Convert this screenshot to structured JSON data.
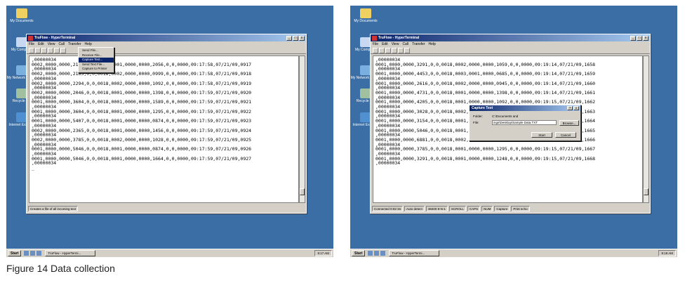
{
  "caption": "Figure 14    Data collection",
  "desktop_icons": [
    {
      "label": "My Documents",
      "icon": "folder-icon"
    },
    {
      "label": "My Computer",
      "icon": "computer-icon"
    },
    {
      "label": "My Network Places",
      "icon": "network-icon"
    },
    {
      "label": "Recycle Bin",
      "icon": "recycle-bin-icon"
    },
    {
      "label": "Internet Explorer",
      "icon": "internet-explorer-icon"
    }
  ],
  "window": {
    "title": "TruFlow - HyperTerminal",
    "menus": [
      "File",
      "Edit",
      "View",
      "Call",
      "Transfer",
      "Help"
    ],
    "controls": [
      "_",
      "□",
      "x"
    ]
  },
  "left": {
    "terminal_lines": [
      ",00000034",
      "0002,0000,0000,2105,0,0,0018,0001,0000,0000,2056,0,0,0000,09:17:58,07/21/09,0917",
      ",00000034",
      "0002,0000,0000,2163,0,0,0018,0002,0000,0000,0999,0,0,0000,09:17:58,07/21/09,0918",
      ",00000034",
      "0002,0000,0000,2294,0,0,0018,0002,0000,0000,1092,0,0,0000,09:17:58,07/21/09,0919",
      ",00000034",
      "0002,0000,0000,2046,0,0,0018,0001,0000,0000,1398,0,0,0000,09:17:59,07/21/09,0920",
      ",00000034",
      "0001,0000,0000,3604,0,0,0018,0001,0000,0000,1589,0,0,0000,09:17:59,07/21/09,0921",
      ",00000034",
      "0001,0000,0000,3604,0,0,0018,0001,0000,0000,1295,0,0,0000,09:17:59,07/21/09,0922",
      ",00000034",
      "0001,0000,0000,5407,0,0,0018,0001,0000,0000,0874,0,0,0000,09:17:59,07/21/09,0923",
      ",00000034",
      "0002,0000,0000,2365,0,0,0018,0001,0000,0000,1456,0,0,0000,09:17:59,07/21/09,0924",
      ",00000034",
      "0002,0000,0000,3785,0,0,0018,0002,0000,0000,1028,0,0,0000,09:17:59,07/21/09,0925",
      ",00000034",
      "0001,0000,0000,5046,0,0,0018,0001,0000,0000,0874,0,0,0000,09:17:59,07/21/09,0926",
      ",00000034",
      "0001,0000,0000,5046,0,0,0018,0001,0000,0000,1664,0,0,0000,09:17:59,07/21/09,0927",
      ",00000034",
      "_"
    ],
    "transfer_menu": [
      "Send File...",
      "Receive File...",
      "Capture Text...",
      "Send Text File...",
      "Capture to Printer"
    ],
    "status": "Creates a file of all incoming text",
    "task_label": "TruFlow - HyperTermi...",
    "clock": "9:17 AM"
  },
  "right": {
    "terminal_lines": [
      ",00000034",
      "0001,0000,0000,3291,0,0,0018,0002,0000,0000,1059,0,0,0000,09:19:14,07/21/09,1658",
      ",00000034",
      "0001,0000,0000,4453,0,0,0018,0003,0001,0000,0685,0,0,0000,09:19:14,07/21/09,1659",
      ",00000034",
      "0001,0000,0000,2616,0,0,0018,0002,0000,0000,0945,0,0,0000,09:19:14,07/21/09,1660",
      ",00000034",
      "0001,0000,0000,4731,0,0,0018,0001,0000,0000,1398,0,0,0000,09:19:14,07/21/09,1661",
      ",00000034",
      "0001,0000,0000,4205,0,0,0018,0001,0000,0000,1092,0,0,0000,09:19:15,07/21/09,1662",
      ",00000034",
      "0001,0000,0000,3028,0,0,0018,0002,0000,0000,0874,0,0,0000,09:19:15,07/21/09,1663",
      ",00000034",
      "0001,0000,0000,3154,0,0,0018,0001,0000,0000,1456,0,0,0000,09:19:15,07/21/09,1664",
      ",00000034",
      "0001,0000,0000,5046,0,0,0018,0001,0000,0000,1344,0,0,0000,09:19:15,07/21/09,1665",
      ",00000034",
      "0001,0000,0000,6881,0,0,0018,0002,0000,0000,0853,0,0,0000,09:19:15,07/21/09,1666",
      ",00000034",
      "0001,0000,0000,3785,0,0,0018,0001,0000,0000,1295,0,0,0000,09:19:15,07/21/09,1667",
      ",00000034",
      "0001,0000,0000,3291,0,0,0018,0001,0000,0000,1248,0,0,0000,09:19:15,07/21/09,1668",
      ",00000034"
    ],
    "dialog": {
      "title": "Capture Text",
      "folder_label": "Folder:",
      "folder_value": "C:\\Documents and",
      "file_label": "File:",
      "file_value": "ings\\Desktop\\Sample Data.TXT",
      "browse": "Browse...",
      "start": "Start",
      "cancel": "Cancel",
      "help": "?",
      "close": "x"
    },
    "status_segments": [
      "Connected 0:02:15",
      "Auto detect",
      "38400 8-N-1",
      "SCROLL",
      "CAPS",
      "NUM",
      "Capture",
      "Print echo"
    ],
    "task_label": "TruFlow - HyperTermi...",
    "clock": "9:18 AM"
  },
  "taskbar": {
    "start": "Start"
  }
}
